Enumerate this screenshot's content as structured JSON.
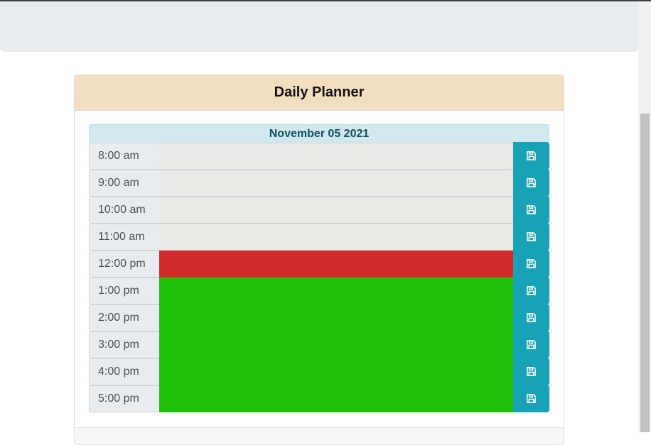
{
  "planner": {
    "title": "Daily Planner",
    "date": "November 05 2021"
  },
  "colors": {
    "past": "#e9e9e6",
    "present": "#d32b2b",
    "future": "#1ec20b",
    "save_button": "#17a2b8",
    "header": "#f3dfbf"
  },
  "hours": [
    {
      "time": "8:00 am",
      "status": "past",
      "task": "",
      "icon": "save-icon"
    },
    {
      "time": "9:00 am",
      "status": "past",
      "task": "",
      "icon": "save-icon"
    },
    {
      "time": "10:00 am",
      "status": "past",
      "task": "",
      "icon": "save-icon"
    },
    {
      "time": "11:00 am",
      "status": "past",
      "task": "",
      "icon": "save-icon"
    },
    {
      "time": "12:00 pm",
      "status": "present",
      "task": "",
      "icon": "save-icon"
    },
    {
      "time": "1:00 pm",
      "status": "future",
      "task": "",
      "icon": "save-icon"
    },
    {
      "time": "2:00 pm",
      "status": "future",
      "task": "",
      "icon": "save-icon"
    },
    {
      "time": "3:00 pm",
      "status": "future",
      "task": "",
      "icon": "save-icon"
    },
    {
      "time": "4:00 pm",
      "status": "future",
      "task": "",
      "icon": "save-icon"
    },
    {
      "time": "5:00 pm",
      "status": "future",
      "task": "",
      "icon": "save-icon"
    }
  ]
}
